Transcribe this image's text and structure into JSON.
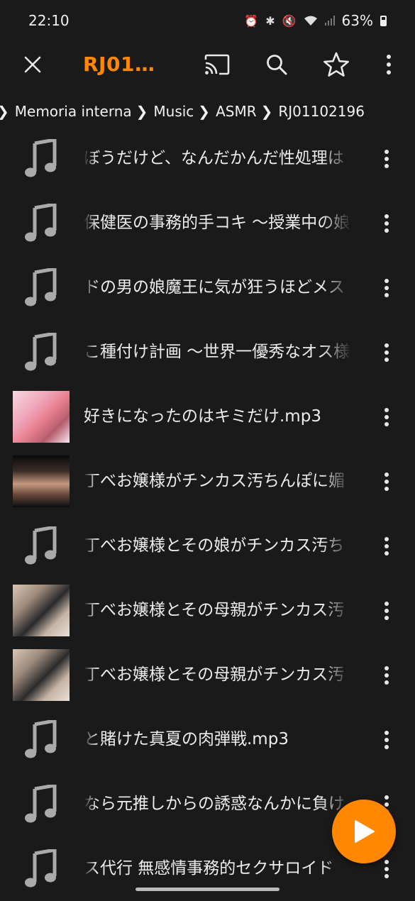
{
  "status_bar": {
    "time": "22:10",
    "battery": "63%",
    "icons": [
      "alarm-icon",
      "bluetooth-icon",
      "mute-icon",
      "wifi-icon",
      "signal-icon",
      "battery-icon"
    ]
  },
  "app_bar": {
    "title": "RJ01…",
    "accent_color": "#ff8800",
    "icons": [
      "close-icon",
      "cast-icon",
      "search-icon",
      "star-icon",
      "more-vert-icon"
    ]
  },
  "breadcrumb": [
    "Memoria interna",
    "Music",
    "ASMR",
    "RJ01102196"
  ],
  "files": [
    {
      "name": "ぼうだけど、なんだかんだ性処理は",
      "thumb": "music-note-icon"
    },
    {
      "name": "保健医の事務的手コキ 〜授業中の娘",
      "thumb": "music-note-icon"
    },
    {
      "name": "ドの男の娘魔王に気が狂うほどメス",
      "thumb": "music-note-icon"
    },
    {
      "name": "こ種付け計画 〜世界一優秀なオス様",
      "thumb": "music-note-icon"
    },
    {
      "name": "好きになったのはキミだけ.mp3",
      "thumb": "cover-art-1"
    },
    {
      "name": "丁べお嬢様がチンカス汚ちんぽに媚",
      "thumb": "cover-art-2"
    },
    {
      "name": "丁べお嬢様とその娘がチンカス汚ち",
      "thumb": "music-note-icon"
    },
    {
      "name": "丁べお嬢様とその母親がチンカス汚",
      "thumb": "cover-art-3"
    },
    {
      "name": "丁べお嬢様とその母親がチンカス汚",
      "thumb": "cover-art-3"
    },
    {
      "name": "と賭けた真夏の肉弾戦.mp3",
      "thumb": "music-note-icon"
    },
    {
      "name": "なら元推しからの誘惑なんかに負け",
      "thumb": "music-note-icon"
    },
    {
      "name": "ス代行 無感情事務的セクサロイド",
      "thumb": "music-note-icon"
    }
  ],
  "fab": {
    "icon": "play-icon"
  }
}
